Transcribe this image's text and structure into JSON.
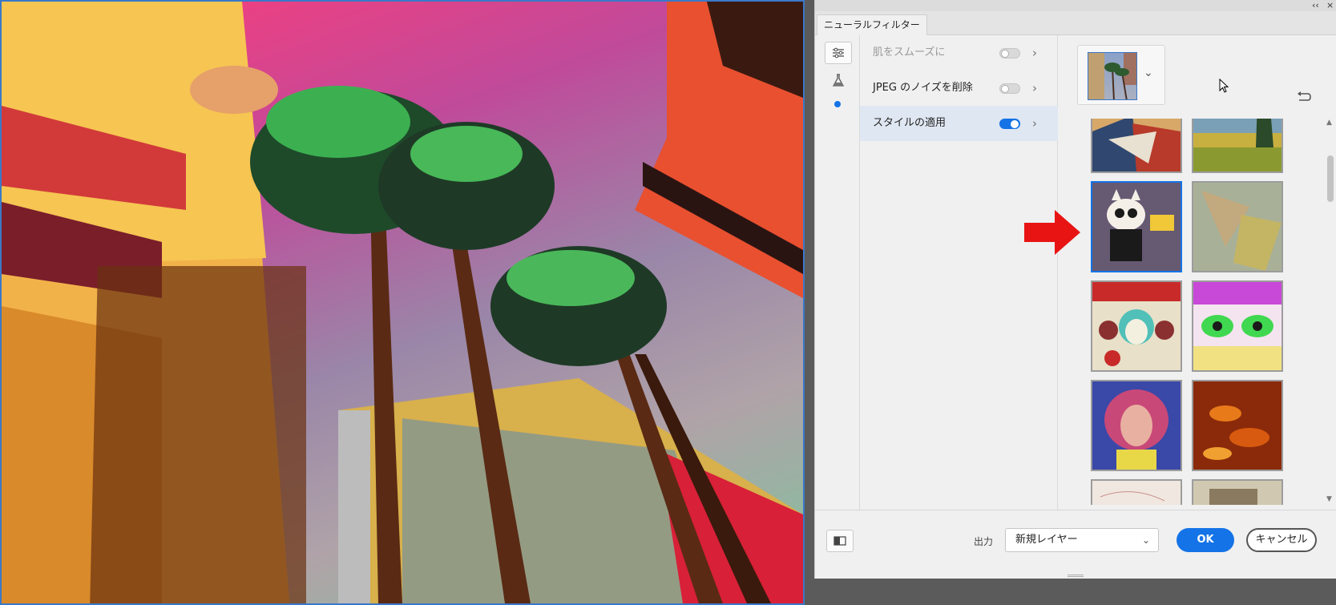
{
  "dialog": {
    "tab_label": "ニューラルフィルター",
    "titlebar_collapse": "‹‹",
    "titlebar_close": "×"
  },
  "sidebar_icons": [
    "sliders-icon",
    "beaker-icon",
    "active-dot"
  ],
  "filters": [
    {
      "label": "肌をスムーズに",
      "enabled": false,
      "disabled": true
    },
    {
      "label": "JPEG のノイズを削除",
      "enabled": false,
      "disabled": false
    },
    {
      "label": "スタイルの適用",
      "enabled": true,
      "active": true
    }
  ],
  "style_gallery": {
    "selected_index": 2,
    "items": [
      "abstract-cubist",
      "wheat-field-landscape",
      "sugar-skull-cat-poster",
      "faded-abstract",
      "tattoo-skull-poster",
      "neon-eyes-popart",
      "colorful-portrait",
      "burning-texture",
      "sketch-a",
      "sketch-b"
    ]
  },
  "footer": {
    "output_label": "出力",
    "output_value": "新規レイヤー",
    "ok_label": "OK",
    "cancel_label": "キャンセル"
  },
  "colors": {
    "accent": "#1473e6",
    "selection_border": "#3a78c8",
    "arrow": "#e81414"
  }
}
